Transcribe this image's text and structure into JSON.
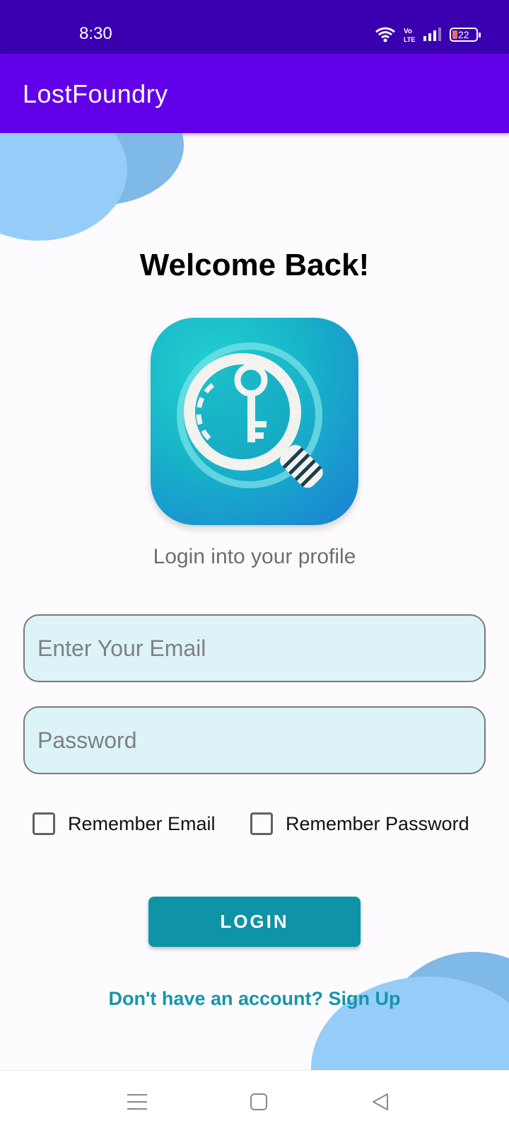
{
  "status_bar": {
    "time": "8:30",
    "battery": "22",
    "icons": [
      "wifi-icon",
      "volte-icon",
      "signal-icon",
      "battery-icon"
    ]
  },
  "app_bar": {
    "title": "LostFoundry"
  },
  "main": {
    "welcome": "Welcome Back!",
    "logo_icon": "magnifier-key-logo-icon",
    "subtitle": "Login into your profile",
    "email_placeholder": "Enter Your Email",
    "password_placeholder": "Password",
    "remember_email_label": "Remember Email",
    "remember_password_label": "Remember Password",
    "remember_email_checked": false,
    "remember_password_checked": false,
    "login_label": "LOGIN",
    "signup_text": "Don't have an account? Sign Up"
  },
  "nav_bar": {
    "icons": [
      "menu-icon",
      "home-square-icon",
      "back-triangle-icon"
    ]
  },
  "colors": {
    "status_bar": "#3a00b0",
    "app_bar": "#6200ea",
    "accent": "#0f93a6",
    "field_bg": "#dcf3f7",
    "blob_light": "#95cdf8",
    "blob_dark": "#7fb9e8"
  }
}
